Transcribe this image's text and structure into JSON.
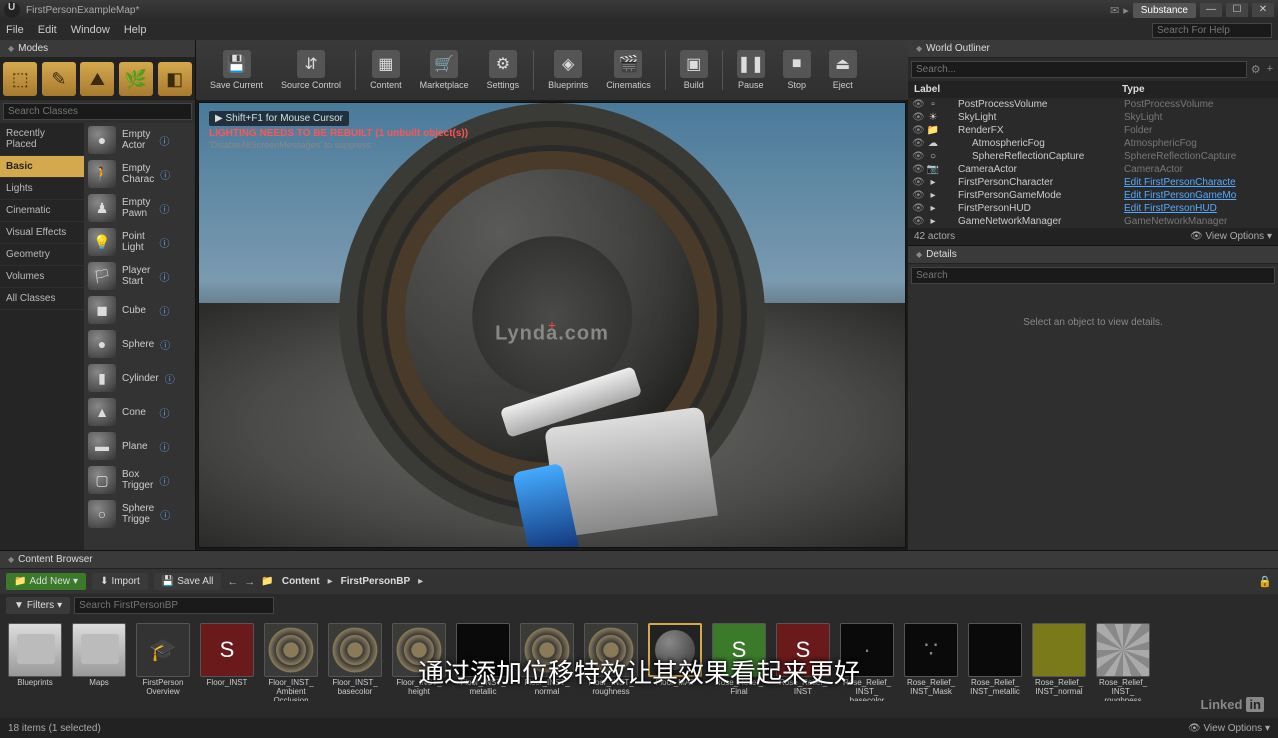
{
  "titlebar": {
    "title": "FirstPersonExampleMap*",
    "substance": "Substance",
    "search_placeholder": "Search For Help"
  },
  "menubar": [
    "File",
    "Edit",
    "Window",
    "Help"
  ],
  "modes": {
    "tab": "Modes",
    "search_placeholder": "Search Classes",
    "categories": [
      "Recently Placed",
      "Basic",
      "Lights",
      "Cinematic",
      "Visual Effects",
      "Geometry",
      "Volumes",
      "All Classes"
    ],
    "active_category": "Basic",
    "actors": [
      {
        "name": "Empty Actor",
        "icon": "●"
      },
      {
        "name": "Empty Charac",
        "icon": "🚶"
      },
      {
        "name": "Empty Pawn",
        "icon": "♟"
      },
      {
        "name": "Point Light",
        "icon": "💡"
      },
      {
        "name": "Player Start",
        "icon": "🏳"
      },
      {
        "name": "Cube",
        "icon": "◼"
      },
      {
        "name": "Sphere",
        "icon": "●"
      },
      {
        "name": "Cylinder",
        "icon": "▮"
      },
      {
        "name": "Cone",
        "icon": "▲"
      },
      {
        "name": "Plane",
        "icon": "▬"
      },
      {
        "name": "Box Trigger",
        "icon": "▢"
      },
      {
        "name": "Sphere Trigge",
        "icon": "○"
      }
    ]
  },
  "toolbar": [
    {
      "label": "Save Current",
      "icon": "💾"
    },
    {
      "label": "Source Control",
      "icon": "⇵"
    },
    {
      "label": "Content",
      "icon": "▦"
    },
    {
      "label": "Marketplace",
      "icon": "🛒"
    },
    {
      "label": "Settings",
      "icon": "⚙"
    },
    {
      "label": "Blueprints",
      "icon": "◈"
    },
    {
      "label": "Cinematics",
      "icon": "🎬"
    },
    {
      "label": "Build",
      "icon": "▣"
    },
    {
      "label": "Pause",
      "icon": "❚❚"
    },
    {
      "label": "Stop",
      "icon": "■"
    },
    {
      "label": "Eject",
      "icon": "⏏"
    }
  ],
  "viewport": {
    "hint": "Shift+F1 for Mouse Cursor",
    "warning": "LIGHTING NEEDS TO BE REBUILT (1 unbuilt object(s))",
    "sub": "'DisableAllScreenMessages' to suppress",
    "sphere_text": "Lynda.com"
  },
  "outliner": {
    "tab": "World Outliner",
    "search_placeholder": "Search...",
    "col_label": "Label",
    "col_type": "Type",
    "rows": [
      {
        "label": "PostProcessVolume",
        "type": "PostProcessVolume",
        "indent": 1,
        "ico": "▫"
      },
      {
        "label": "SkyLight",
        "type": "SkyLight",
        "indent": 1,
        "ico": "☀"
      },
      {
        "label": "RenderFX",
        "type": "Folder",
        "indent": 1,
        "ico": "📁"
      },
      {
        "label": "AtmosphericFog",
        "type": "AtmosphericFog",
        "indent": 2,
        "ico": "☁"
      },
      {
        "label": "SphereReflectionCapture",
        "type": "SphereReflectionCapture",
        "indent": 2,
        "ico": "○"
      },
      {
        "label": "CameraActor",
        "type": "CameraActor",
        "indent": 1,
        "ico": "📷"
      },
      {
        "label": "FirstPersonCharacter",
        "type": "Edit FirstPersonCharacte",
        "indent": 1,
        "ico": "▸",
        "edit": true
      },
      {
        "label": "FirstPersonGameMode",
        "type": "Edit FirstPersonGameMo",
        "indent": 1,
        "ico": "▸",
        "edit": true
      },
      {
        "label": "FirstPersonHUD",
        "type": "Edit FirstPersonHUD",
        "indent": 1,
        "ico": "▸",
        "edit": true
      },
      {
        "label": "GameNetworkManager",
        "type": "GameNetworkManager",
        "indent": 1,
        "ico": "▸"
      }
    ],
    "footer_count": "42 actors",
    "footer_view": "View Options"
  },
  "details": {
    "tab": "Details",
    "message": "Select an object to view details."
  },
  "content_browser": {
    "tab": "Content Browser",
    "add_new": "Add New",
    "import": "Import",
    "save_all": "Save All",
    "path": [
      "Content",
      "FirstPersonBP"
    ],
    "filters": "Filters",
    "filter_placeholder": "Search FirstPersonBP",
    "assets": [
      {
        "name": "Blueprints",
        "cls": "folder"
      },
      {
        "name": "Maps",
        "cls": "folder"
      },
      {
        "name": "FirstPerson Overview",
        "cls": "darkblue",
        "ico": "🎓"
      },
      {
        "name": "Floor_INST",
        "cls": "darkred",
        "ico": "S"
      },
      {
        "name": "Floor_INST_ Ambient Occlusion",
        "cls": "pattern"
      },
      {
        "name": "Floor_INST_ basecolor",
        "cls": "pattern"
      },
      {
        "name": "Floor_INST_ height",
        "cls": "pattern"
      },
      {
        "name": "Floor_INST_ metallic",
        "cls": "black"
      },
      {
        "name": "Floor_INST_ normal",
        "cls": "pattern"
      },
      {
        "name": "Floor_INST_ roughness",
        "cls": "pattern"
      },
      {
        "name": "Floor_MAT",
        "cls": "circ",
        "sel": true
      },
      {
        "name": "Rose_Relief_ Final",
        "cls": "green",
        "ico": "S"
      },
      {
        "name": "Rose_Relief_ INST",
        "cls": "darkred",
        "ico": "S"
      },
      {
        "name": "Rose_Relief_ INST_ basecolor",
        "cls": "black",
        "ico": "·"
      },
      {
        "name": "Rose_Relief_ INST_Mask",
        "cls": "black",
        "ico": "∵"
      },
      {
        "name": "Rose_Relief_ INST_metallic",
        "cls": "black"
      },
      {
        "name": "Rose_Relief_ INST_normal",
        "cls": "olive"
      },
      {
        "name": "Rose_Relief_ INST_ roughness",
        "cls": "noise"
      }
    ],
    "status": "18 items (1 selected)",
    "view_options": "View Options"
  },
  "subtitle": "通过添加位移特效让其效果看起来更好",
  "linkedin": "Linked"
}
